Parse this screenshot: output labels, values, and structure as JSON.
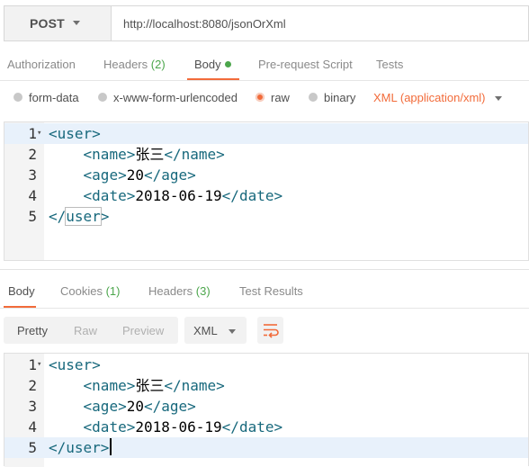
{
  "request": {
    "method": "POST",
    "url": "http://localhost:8080/jsonOrXml"
  },
  "request_tabs": [
    {
      "label": "Authorization",
      "count": "",
      "active": false
    },
    {
      "label": "Headers",
      "count": "(2)",
      "active": false
    },
    {
      "label": "Body",
      "count": "",
      "active": true
    },
    {
      "label": "Pre-request Script",
      "count": "",
      "active": false
    },
    {
      "label": "Tests",
      "count": "",
      "active": false
    }
  ],
  "body_types": [
    {
      "label": "form-data",
      "selected": false
    },
    {
      "label": "x-www-form-urlencoded",
      "selected": false
    },
    {
      "label": "raw",
      "selected": true
    },
    {
      "label": "binary",
      "selected": false
    }
  ],
  "raw_format": "XML (application/xml)",
  "request_code": [
    {
      "num": "1",
      "fold": "▾",
      "open": "<",
      "tag": "user",
      "close": ">",
      "text": "",
      "end_open": "",
      "end_tag": "",
      "end_close": "",
      "indent": ""
    },
    {
      "num": "2",
      "fold": "",
      "open": "<",
      "tag": "name",
      "close": ">",
      "text": "张三",
      "end_open": "</",
      "end_tag": "name",
      "end_close": ">",
      "indent": "    "
    },
    {
      "num": "3",
      "fold": "",
      "open": "<",
      "tag": "age",
      "close": ">",
      "text": "20",
      "end_open": "</",
      "end_tag": "age",
      "end_close": ">",
      "indent": "    "
    },
    {
      "num": "4",
      "fold": "",
      "open": "<",
      "tag": "date",
      "close": ">",
      "text": "2018-06-19",
      "end_open": "</",
      "end_tag": "date",
      "end_close": ">",
      "indent": "    "
    },
    {
      "num": "5",
      "fold": "",
      "open": "</",
      "tag": "user",
      "close": ">",
      "text": "",
      "end_open": "",
      "end_tag": "",
      "end_close": "",
      "indent": ""
    }
  ],
  "response_tabs": [
    {
      "label": "Body",
      "count": "",
      "active": true
    },
    {
      "label": "Cookies",
      "count": "(1)",
      "active": false
    },
    {
      "label": "Headers",
      "count": "(3)",
      "active": false
    },
    {
      "label": "Test Results",
      "count": "",
      "active": false
    }
  ],
  "view_modes": [
    {
      "label": "Pretty",
      "active": true
    },
    {
      "label": "Raw",
      "active": false
    },
    {
      "label": "Preview",
      "active": false
    }
  ],
  "response_format": "XML",
  "wrap_icon": "wrap-lines-icon",
  "response_code": [
    {
      "num": "1",
      "fold": "▾",
      "open": "<",
      "tag": "user",
      "close": ">",
      "text": "",
      "end_open": "",
      "end_tag": "",
      "end_close": "",
      "indent": ""
    },
    {
      "num": "2",
      "fold": "",
      "open": "<",
      "tag": "name",
      "close": ">",
      "text": "张三",
      "end_open": "</",
      "end_tag": "name",
      "end_close": ">",
      "indent": "    "
    },
    {
      "num": "3",
      "fold": "",
      "open": "<",
      "tag": "age",
      "close": ">",
      "text": "20",
      "end_open": "</",
      "end_tag": "age",
      "end_close": ">",
      "indent": "    "
    },
    {
      "num": "4",
      "fold": "",
      "open": "<",
      "tag": "date",
      "close": ">",
      "text": "2018-06-19",
      "end_open": "</",
      "end_tag": "date",
      "end_close": ">",
      "indent": "    "
    },
    {
      "num": "5",
      "fold": "",
      "open": "</",
      "tag": "user",
      "close": ">",
      "text": "",
      "end_open": "",
      "end_tag": "",
      "end_close": "",
      "indent": ""
    }
  ],
  "colors": {
    "accent": "#f26b3a",
    "count": "#4ca64c",
    "xml_tag": "#17687c"
  }
}
